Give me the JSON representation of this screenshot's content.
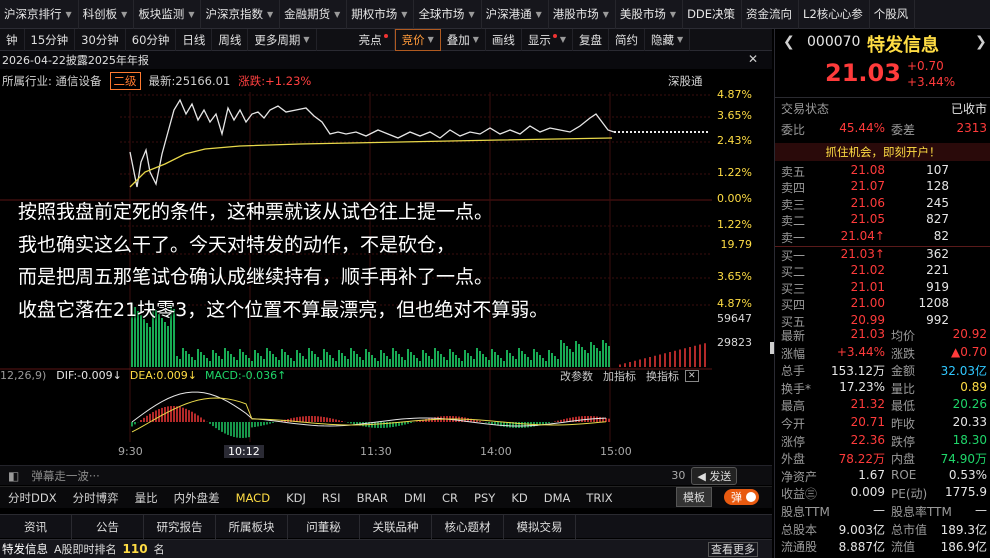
{
  "menu": [
    "沪深京排行",
    "科创板",
    "板块监测",
    "沪深京指数",
    "金融期货",
    "期权市场",
    "全球市场",
    "沪深港通",
    "港股市场",
    "美股市场",
    "DDE决策",
    "资金流向",
    "L2核心心参",
    "个股风"
  ],
  "toolbar": {
    "periods": [
      "15分钟",
      "30分钟",
      "60分钟",
      "日线",
      "周线",
      "更多周期"
    ],
    "first": "钟",
    "right": [
      "亮点",
      "竞价",
      "叠加",
      "画线",
      "显示",
      "复盘",
      "简约",
      "隐藏"
    ]
  },
  "info_bar": {
    "title": "2026-04-22披露2025年年报"
  },
  "chart_header": {
    "industry": "所属行业: 通信设备",
    "tag": "二级",
    "latest": "最新:25166.01",
    "change": "涨跌:+1.23%",
    "right": "深股通"
  },
  "price_axis": {
    "right": [
      {
        "v": "4.87%",
        "c": "red"
      },
      {
        "v": "3.65%",
        "c": "red"
      },
      {
        "v": "2.43%",
        "c": "red"
      },
      {
        "v": "1.22%",
        "c": "red"
      },
      {
        "v": "0.00%",
        "c": "wh"
      },
      {
        "v": "1.22%",
        "c": "grn"
      },
      {
        "v": "19.79",
        "c": "wh"
      },
      {
        "v": "3.65%",
        "c": "grn"
      },
      {
        "v": "4.87%",
        "c": "grn"
      }
    ]
  },
  "volume_axis": {
    "top": "59647",
    "mid": "29823"
  },
  "subtitles": [
    "按照我盘前定死的条件，这种票就该从试仓往上提一点。",
    "我也确实这么干了。今天对特发的动作，不是砍仓，",
    "而是把周五那笔试仓确认成继续持有，顺手再补了一点。",
    "收盘它落在21块零3，这个位置不算最漂亮，但也绝对不算弱。"
  ],
  "macd": {
    "params": "12,26,9)",
    "dif": "DIF:-0.009↓",
    "dea": "DEA:0.009↓",
    "macd": "MACD:-0.036↑",
    "actions": [
      "改参数",
      "加指标",
      "换指标"
    ]
  },
  "time_axis": [
    "9:30",
    "10:12",
    "11:30",
    "14:00",
    "15:00"
  ],
  "danmu": {
    "placeholder": "弹幕走一波···",
    "count": "30",
    "send": "发送"
  },
  "indicators": [
    "分时DDX",
    "分时博弈",
    "量比",
    "内外盘差",
    "MACD",
    "KDJ",
    "RSI",
    "BRAR",
    "DMI",
    "CR",
    "PSY",
    "KD",
    "DMA",
    "TRIX"
  ],
  "indicator_right": {
    "template": "模板",
    "toggle": "弹"
  },
  "bottom_tabs": [
    "资讯",
    "公告",
    "研究报告",
    "所属板块",
    "问董秘",
    "关联品种",
    "核心题材",
    "模拟交易"
  ],
  "status": {
    "name": "特发信息",
    "rank_label": "A股即时排名",
    "rank": "110",
    "rank_unit": "名",
    "more": "查看更多"
  },
  "quote": {
    "code": "000070",
    "name": "特发信息",
    "price": "21.03",
    "change": "+0.70",
    "pct": "+3.44%",
    "state_label": "交易状态",
    "state": "已收市",
    "weibi_label": "委比",
    "weibi": "45.44%",
    "weicha_label": "委差",
    "weicha": "2313",
    "promo": "抓住机会，即刻开户！"
  },
  "asks": [
    {
      "l": "卖五",
      "p": "21.08",
      "v": "107"
    },
    {
      "l": "卖四",
      "p": "21.07",
      "v": "128"
    },
    {
      "l": "卖三",
      "p": "21.06",
      "v": "245"
    },
    {
      "l": "卖二",
      "p": "21.05",
      "v": "827"
    },
    {
      "l": "卖一",
      "p": "21.04↑",
      "v": "82"
    }
  ],
  "bids": [
    {
      "l": "买一",
      "p": "21.03↑",
      "v": "362"
    },
    {
      "l": "买二",
      "p": "21.02",
      "v": "221"
    },
    {
      "l": "买三",
      "p": "21.01",
      "v": "919"
    },
    {
      "l": "买四",
      "p": "21.00",
      "v": "1208"
    },
    {
      "l": "买五",
      "p": "20.99",
      "v": "992"
    }
  ],
  "stats": [
    {
      "l1": "最新",
      "v1": "21.03",
      "c1": "red",
      "l2": "均价",
      "v2": "20.92",
      "c2": "red"
    },
    {
      "l1": "涨幅",
      "v1": "+3.44%",
      "c1": "red",
      "l2": "涨跌",
      "v2": "▲0.70",
      "c2": "red"
    },
    {
      "l1": "总手",
      "v1": "153.12万",
      "c1": "wh",
      "l2": "金额",
      "v2": "32.03亿",
      "c2": "cy"
    },
    {
      "l1": "换手*",
      "v1": "17.23%",
      "c1": "wh",
      "l2": "量比",
      "v2": "0.89",
      "c2": "yl"
    },
    {
      "l1": "最高",
      "v1": "21.32",
      "c1": "red",
      "l2": "最低",
      "v2": "20.26",
      "c2": "grn"
    },
    {
      "l1": "今开",
      "v1": "20.71",
      "c1": "red",
      "l2": "昨收",
      "v2": "20.33",
      "c2": "wh"
    },
    {
      "l1": "涨停",
      "v1": "22.36",
      "c1": "red",
      "l2": "跌停",
      "v2": "18.30",
      "c2": "grn"
    },
    {
      "l1": "外盘",
      "v1": "78.22万",
      "c1": "red",
      "l2": "内盘",
      "v2": "74.90万",
      "c2": "grn"
    },
    {
      "l1": "净资产",
      "v1": "1.67",
      "c1": "wh",
      "l2": "ROE",
      "v2": "0.53%",
      "c2": "wh"
    },
    {
      "l1": "收益㊂",
      "v1": "0.009",
      "c1": "wh",
      "l2": "PE(动)",
      "v2": "1775.9",
      "c2": "wh"
    },
    {
      "l1": "股息TTM",
      "v1": "—",
      "c1": "wh",
      "l2": "股息率TTM",
      "v2": "—",
      "c2": "wh"
    },
    {
      "l1": "总股本",
      "v1": "9.003亿",
      "c1": "wh",
      "l2": "总市值",
      "v2": "189.3亿",
      "c2": "wh"
    },
    {
      "l1": "流通股",
      "v1": "8.887亿",
      "c1": "wh",
      "l2": "流值",
      "v2": "186.9亿",
      "c2": "wh"
    }
  ],
  "colors": {
    "up": "#ff3b3b",
    "down": "#1fd66a",
    "avg": "#e8d84a",
    "price": "#e6e6e6",
    "bg": "#000000"
  }
}
